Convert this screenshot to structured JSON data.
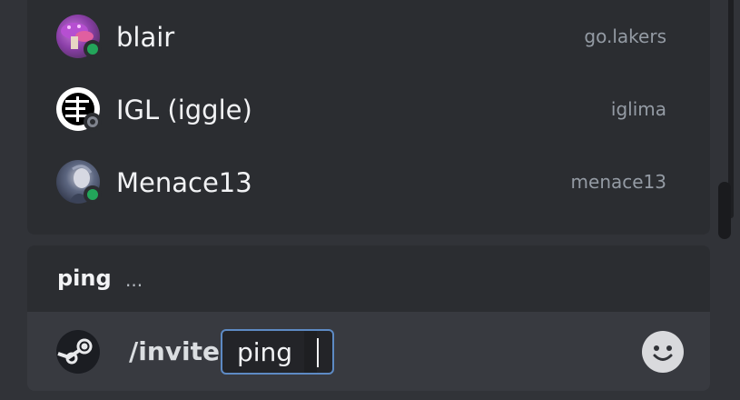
{
  "members": [
    {
      "display_name": "blair",
      "username": "go.lakers",
      "status": "online"
    },
    {
      "display_name": "IGL (iggle)",
      "username": "iglima",
      "status": "offline"
    },
    {
      "display_name": "Menace13",
      "username": "menace13",
      "status": "online"
    }
  ],
  "command": {
    "current_option": "ping",
    "option_ellipsis": "...",
    "name": "/invite",
    "input_label": "ping"
  },
  "colors": {
    "online": "#23a55a",
    "offline": "#80848e",
    "focus_border": "#5d8ac4"
  },
  "icons": {
    "status_offline": "offline-status-icon",
    "command_app": "steam-icon",
    "emoji": "emoji-icon"
  }
}
